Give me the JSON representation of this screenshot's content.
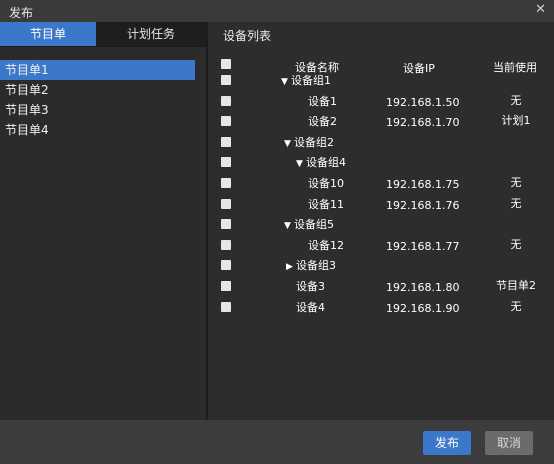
{
  "window": {
    "title": "发布",
    "close_glyph": "✕"
  },
  "tabs": [
    {
      "label": "节目单"
    },
    {
      "label": "计划任务"
    }
  ],
  "programs": [
    {
      "label": "节目单1",
      "selected": true
    },
    {
      "label": "节目单2"
    },
    {
      "label": "节目单3"
    },
    {
      "label": "节目单4"
    }
  ],
  "device_panel": {
    "title": "设备列表",
    "headers": {
      "name": "设备名称",
      "ip": "设备IP",
      "in_use": "当前使用"
    },
    "rows": [
      {
        "name": "设备组1",
        "arrow": "▼",
        "ip": "",
        "in_use": ""
      },
      {
        "name": "设备1",
        "arrow": "",
        "ip": "192.168.1.50",
        "in_use": "无"
      },
      {
        "name": "设备2",
        "arrow": "",
        "ip": "192.168.1.70",
        "in_use": "计划1"
      },
      {
        "name": "设备组2",
        "arrow": "▼",
        "ip": "",
        "in_use": ""
      },
      {
        "name": "设备组4",
        "arrow": "▼",
        "ip": "",
        "in_use": ""
      },
      {
        "name": "设备10",
        "arrow": "",
        "ip": "192.168.1.75",
        "in_use": "无"
      },
      {
        "name": "设备11",
        "arrow": "",
        "ip": "192.168.1.76",
        "in_use": "无"
      },
      {
        "name": "设备组5",
        "arrow": "▼",
        "ip": "",
        "in_use": ""
      },
      {
        "name": "设备12",
        "arrow": "",
        "ip": "192.168.1.77",
        "in_use": "无"
      },
      {
        "name": "设备组3",
        "arrow": "▶",
        "ip": "",
        "in_use": ""
      },
      {
        "name": "设备3",
        "arrow": "",
        "ip": "192.168.1.80",
        "in_use": "节目单2"
      },
      {
        "name": "设备4",
        "arrow": "",
        "ip": "192.168.1.90",
        "in_use": "无"
      }
    ]
  },
  "footer": {
    "ok_label": "发布",
    "cancel_label": "取消"
  }
}
